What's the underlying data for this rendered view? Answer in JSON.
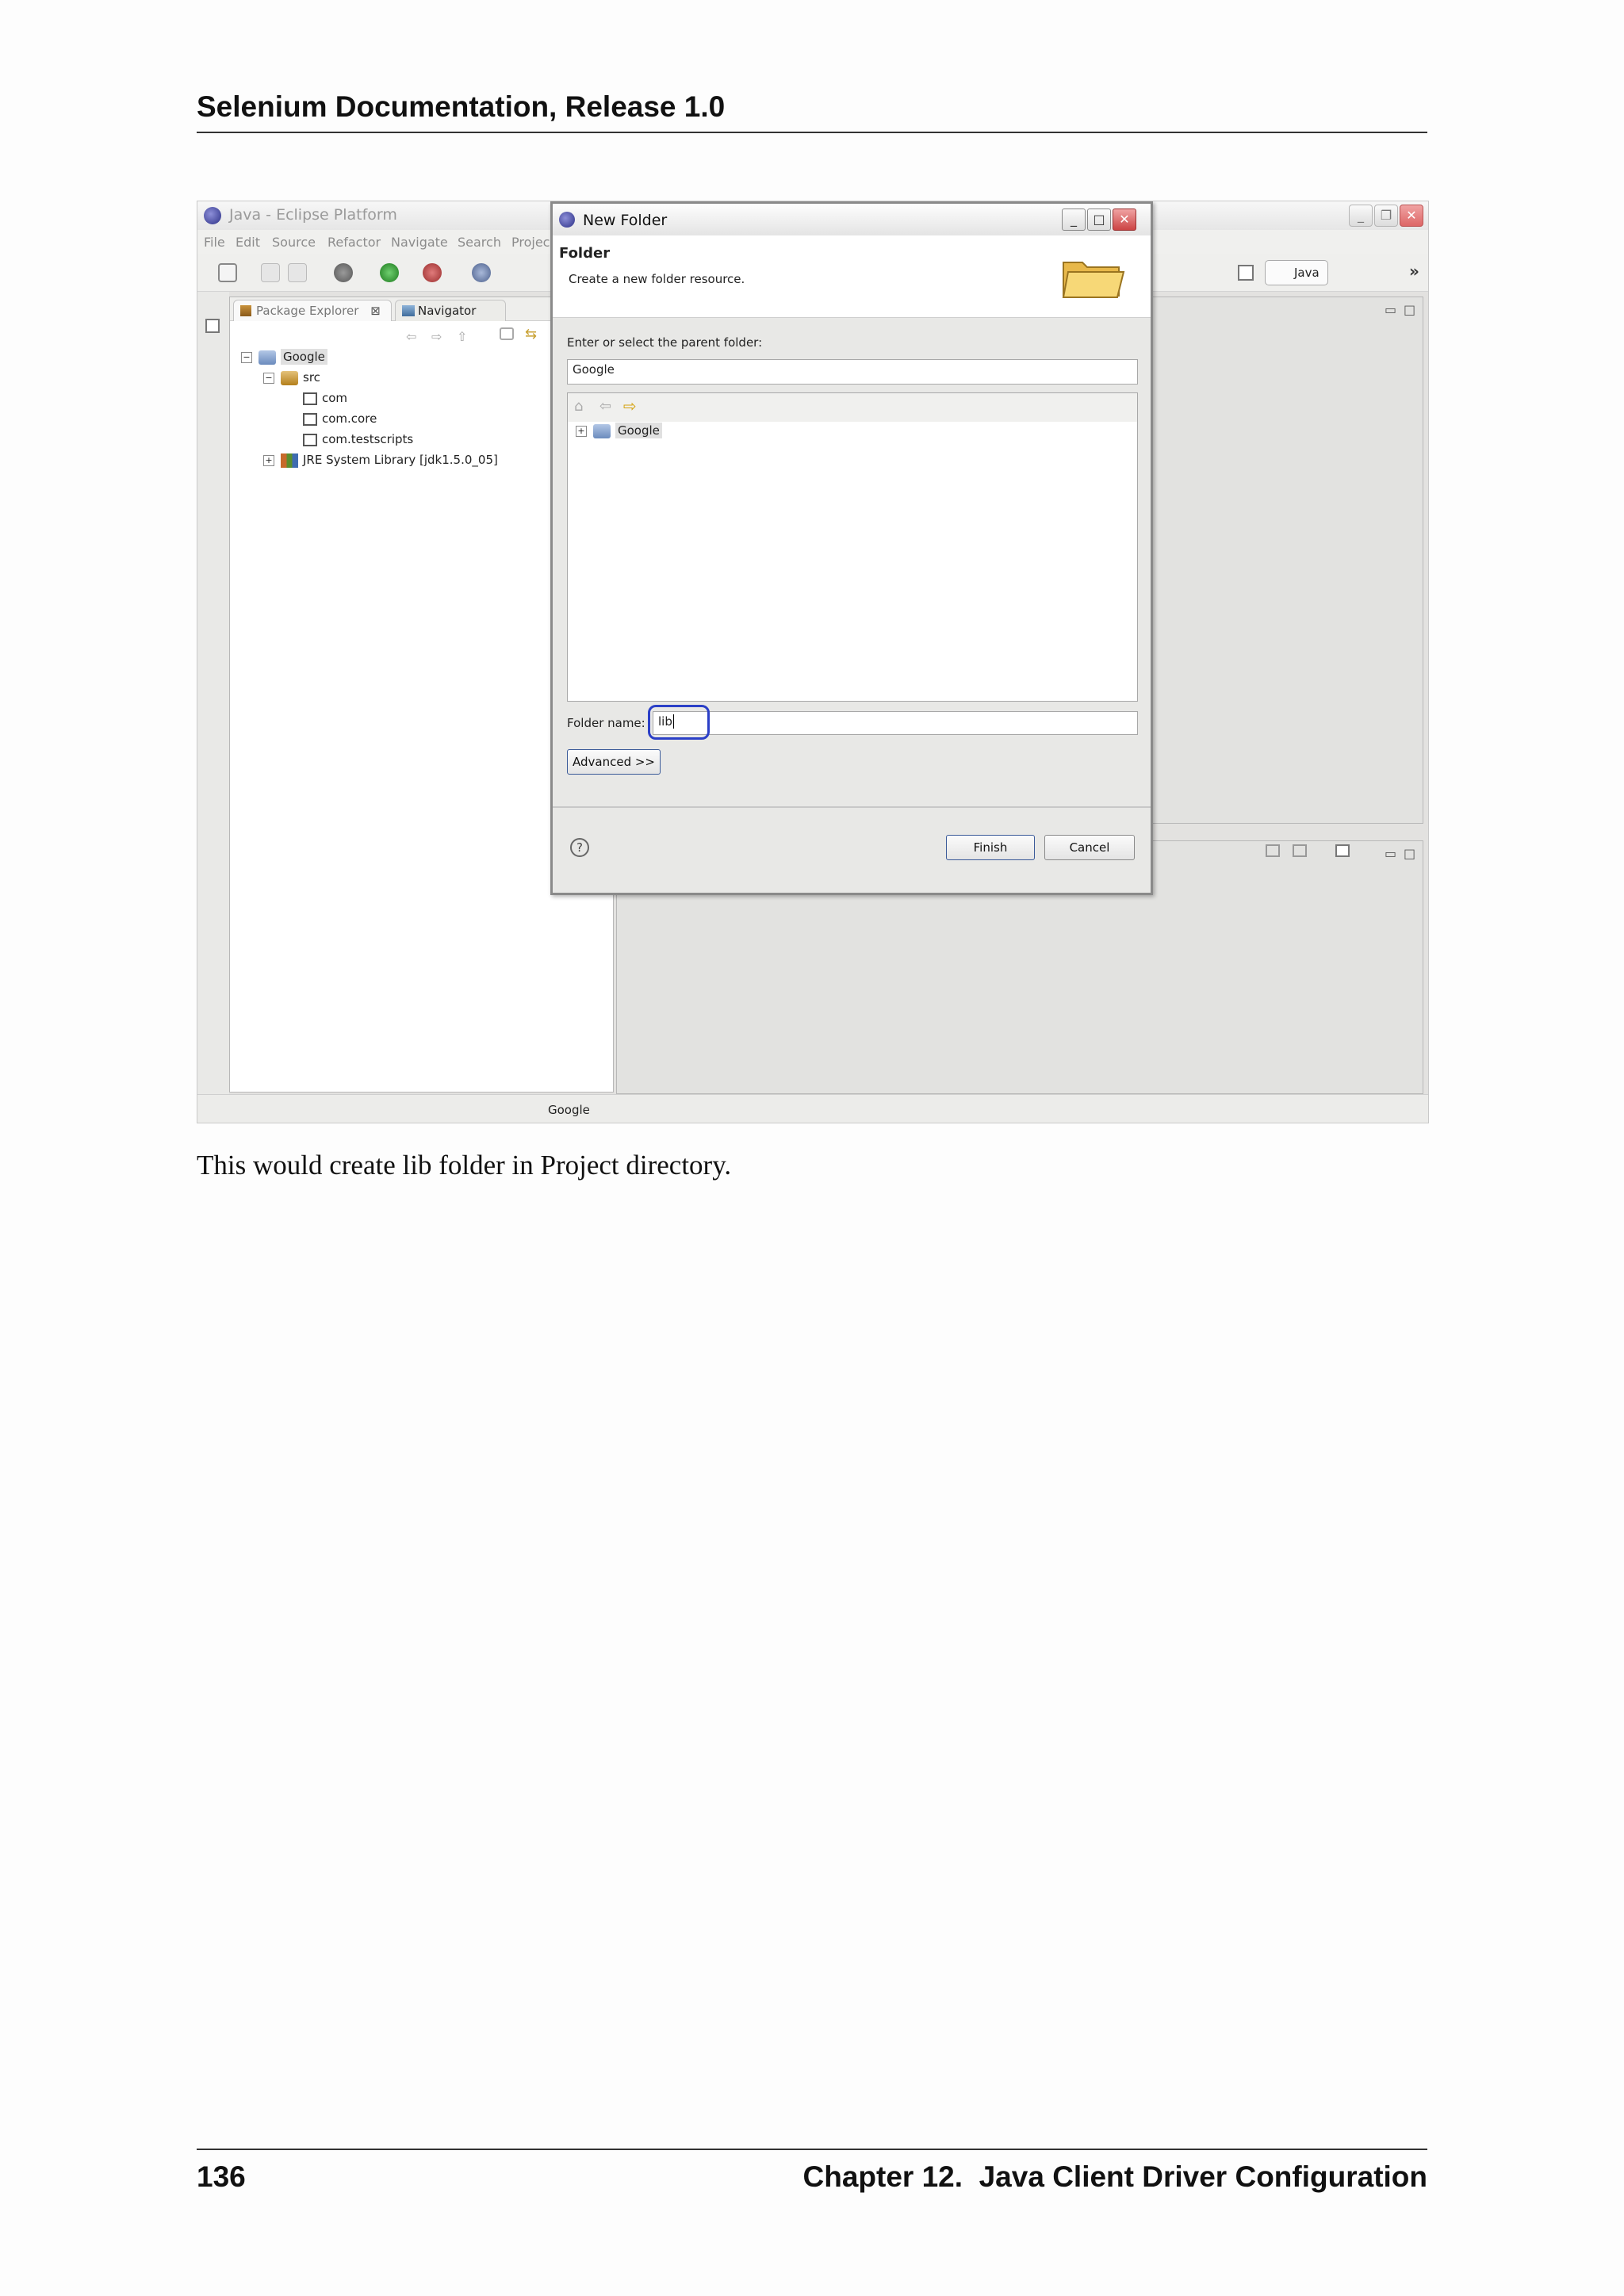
{
  "page": {
    "header_title": "Selenium Documentation, Release 1.0",
    "body_text": "This would create lib folder in Project directory.",
    "page_number": "136",
    "chapter_title": "Chapter 12.  Java Client Driver Configuration"
  },
  "eclipse": {
    "window_title": "Java - Eclipse Platform",
    "menu": [
      "File",
      "Edit",
      "Source",
      "Refactor",
      "Navigate",
      "Search",
      "Projec"
    ],
    "perspective": "Java",
    "tabs": [
      "Package Explorer",
      "Navigator"
    ],
    "tree": {
      "project": "Google",
      "src": "src",
      "packages": [
        "com",
        "com.core",
        "com.testscripts"
      ],
      "library": "JRE System Library [jdk1.5.0_05]"
    },
    "status": "Google"
  },
  "dialog": {
    "title": "New Folder",
    "heading": "Folder",
    "description": "Create a new folder resource.",
    "parent_label": "Enter or select the parent folder:",
    "parent_value": "Google",
    "tree_item": "Google",
    "folder_name_label": "Folder name:",
    "folder_name_value": "lib",
    "advanced_label": "Advanced >>",
    "finish_label": "Finish",
    "cancel_label": "Cancel",
    "help_symbol": "?"
  },
  "colors": {
    "highlight_ring": "#2b3fc7",
    "close_button": "#cc4444",
    "page_background": "#fdfdfd"
  }
}
